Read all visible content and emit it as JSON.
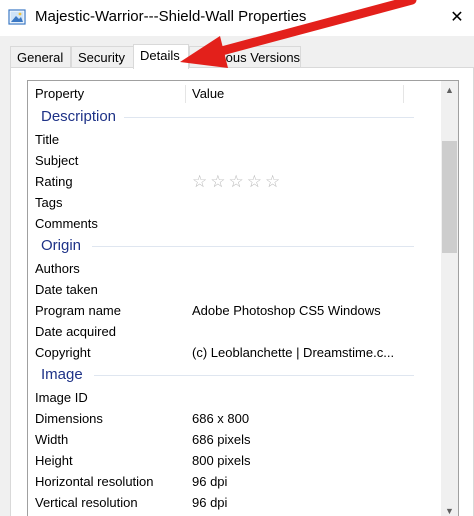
{
  "window": {
    "title": "Majestic-Warrior---Shield-Wall Properties",
    "close_glyph": "✕"
  },
  "tabs": [
    {
      "label": "General"
    },
    {
      "label": "Security"
    },
    {
      "label": "Details"
    },
    {
      "label": "Previous Versions"
    }
  ],
  "columns": {
    "property": "Property",
    "value": "Value"
  },
  "rating": {
    "stars": "☆☆☆☆☆",
    "filled": 0,
    "max": 5
  },
  "groups": {
    "description": {
      "label": "Description",
      "rows": [
        {
          "property": "Title",
          "value": ""
        },
        {
          "property": "Subject",
          "value": ""
        },
        {
          "property": "Rating",
          "value": ""
        },
        {
          "property": "Tags",
          "value": ""
        },
        {
          "property": "Comments",
          "value": ""
        }
      ]
    },
    "origin": {
      "label": "Origin",
      "rows": [
        {
          "property": "Authors",
          "value": ""
        },
        {
          "property": "Date taken",
          "value": ""
        },
        {
          "property": "Program name",
          "value": "Adobe Photoshop CS5 Windows"
        },
        {
          "property": "Date acquired",
          "value": ""
        },
        {
          "property": "Copyright",
          "value": "(c) Leoblanchette | Dreamstime.c..."
        }
      ]
    },
    "image": {
      "label": "Image",
      "rows": [
        {
          "property": "Image ID",
          "value": ""
        },
        {
          "property": "Dimensions",
          "value": "686 x 800"
        },
        {
          "property": "Width",
          "value": "686 pixels"
        },
        {
          "property": "Height",
          "value": "800 pixels"
        },
        {
          "property": "Horizontal resolution",
          "value": "96 dpi"
        },
        {
          "property": "Vertical resolution",
          "value": "96 dpi"
        }
      ]
    }
  },
  "colors": {
    "group_label": "#1e3287",
    "annotation_arrow": "#e3201b",
    "stars": "#b8b8b8"
  },
  "scrollbar": {
    "up_glyph": "▲",
    "down_glyph": "▼"
  }
}
